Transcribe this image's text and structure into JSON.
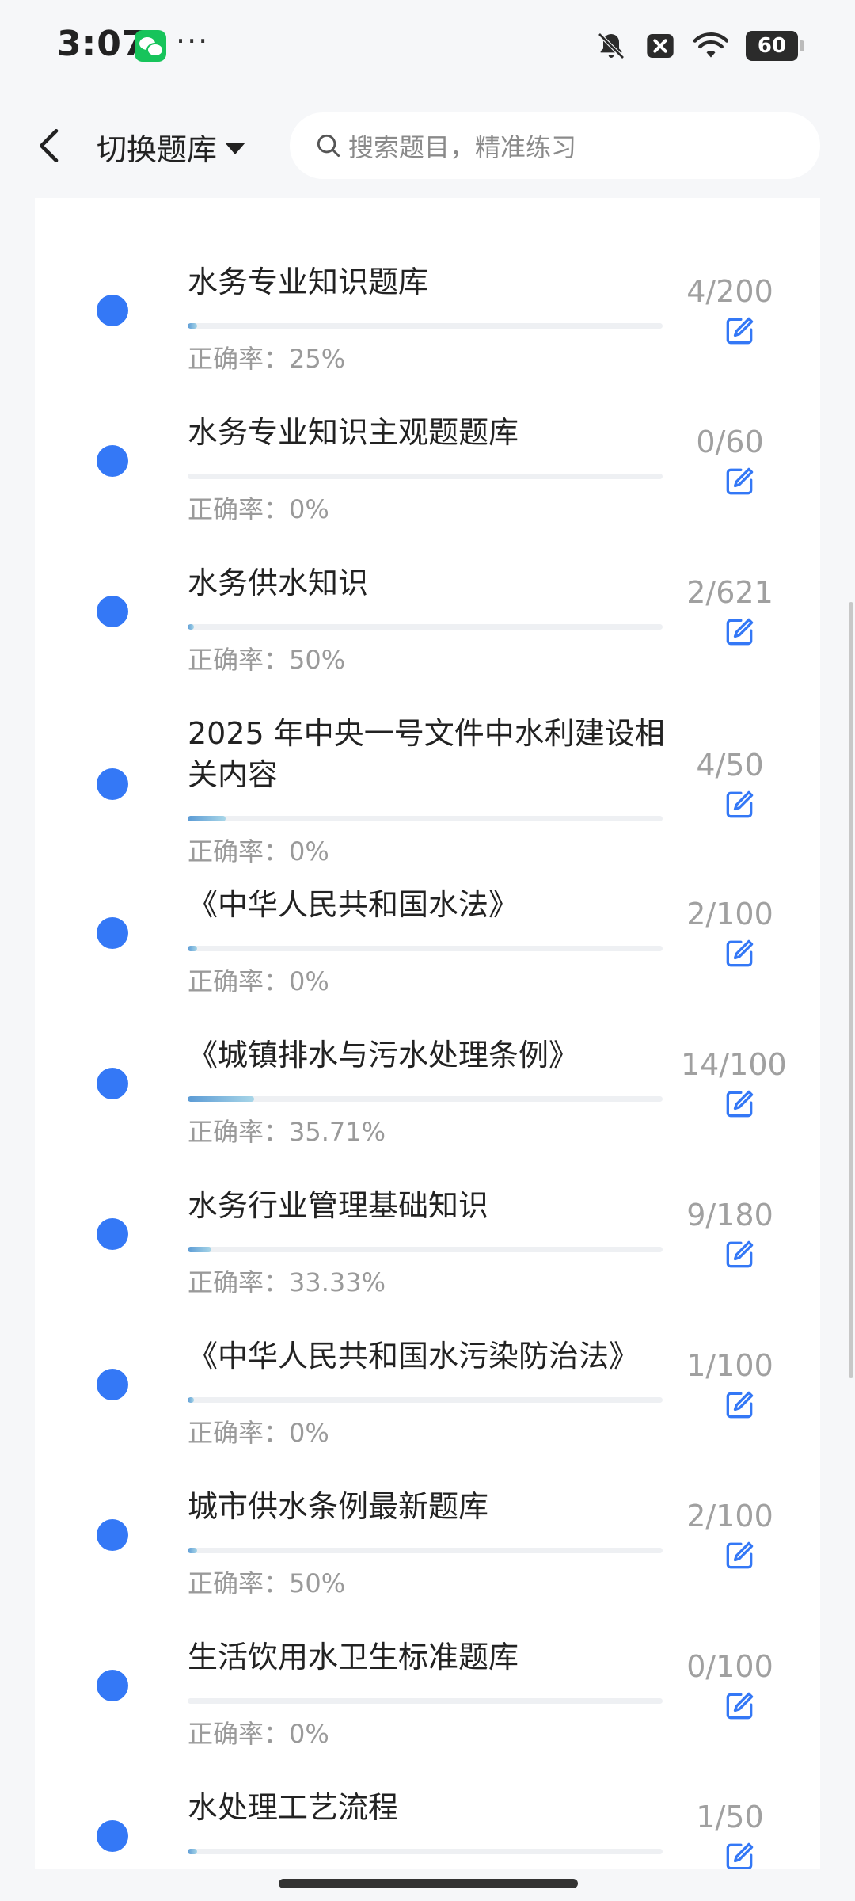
{
  "status_bar": {
    "time": "3:07",
    "battery": "60",
    "icons": [
      "wechat-icon",
      "more-icon",
      "mute-bell-icon",
      "x-box-icon",
      "wifi-icon",
      "battery-icon"
    ]
  },
  "header": {
    "switch_label": "切换题库",
    "search_placeholder": "搜索题目，精准练习"
  },
  "colors": {
    "accent": "#3478f6",
    "progress_fill": "#5b9bd5",
    "progress_light": "#a8d6e8",
    "muted_text": "#9a9a9a"
  },
  "partial_top_item": {
    "accuracy": "正确率：25%"
  },
  "items": [
    {
      "title": "水务专业知识题库",
      "accuracy": "正确率：25%",
      "count": "4/200",
      "progress": 0.02
    },
    {
      "title": "水务专业知识主观题题库",
      "accuracy": "正确率：0%",
      "count": "0/60",
      "progress": 0
    },
    {
      "title": "水务供水知识",
      "accuracy": "正确率：50%",
      "count": "2/621",
      "progress": 0.003
    },
    {
      "title": "2025 年中央一号文件中水利建设相关内容",
      "accuracy": "正确率：0%",
      "count": "4/50",
      "progress": 0.08
    },
    {
      "title": "《中华人民共和国水法》",
      "accuracy": "正确率：0%",
      "count": "2/100",
      "progress": 0.02
    },
    {
      "title": "《城镇排水与污水处理条例》",
      "accuracy": "正确率：35.71%",
      "count": "14/100",
      "progress": 0.14
    },
    {
      "title": "水务行业管理基础知识",
      "accuracy": "正确率：33.33%",
      "count": "9/180",
      "progress": 0.05
    },
    {
      "title": "《中华人民共和国水污染防治法》",
      "accuracy": "正确率：0%",
      "count": "1/100",
      "progress": 0.01
    },
    {
      "title": "城市供水条例最新题库",
      "accuracy": "正确率：50%",
      "count": "2/100",
      "progress": 0.02
    },
    {
      "title": "生活饮用水卫生标准题库",
      "accuracy": "正确率：0%",
      "count": "0/100",
      "progress": 0
    },
    {
      "title": "水处理工艺流程",
      "accuracy": "",
      "count": "1/50",
      "progress": 0.02
    }
  ]
}
